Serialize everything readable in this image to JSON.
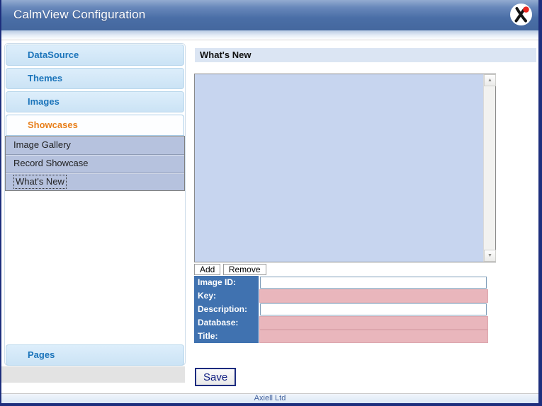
{
  "window": {
    "title": "CalmView Configuration",
    "logo_name": "axiell-logo"
  },
  "sidebar": {
    "sections": [
      {
        "label": "DataSource",
        "state": "collapsed"
      },
      {
        "label": "Themes",
        "state": "collapsed"
      },
      {
        "label": "Images",
        "state": "collapsed"
      },
      {
        "label": "Showcases",
        "state": "expanded",
        "items": [
          {
            "label": "Image Gallery",
            "selected": false
          },
          {
            "label": "Record Showcase",
            "selected": false
          },
          {
            "label": "What's New",
            "selected": true
          }
        ]
      },
      {
        "label": "Pages",
        "state": "collapsed"
      }
    ]
  },
  "main": {
    "heading": "What's New",
    "listbox": {
      "items": [],
      "scroll_up_glyph": "▲",
      "scroll_down_glyph": "▼"
    },
    "toolbar": {
      "add_label": "Add",
      "remove_label": "Remove"
    },
    "form": {
      "fields": [
        {
          "label": "Image ID:",
          "value": "",
          "state": "editable"
        },
        {
          "label": "Key:",
          "value": "",
          "state": "locked"
        },
        {
          "label": "Description:",
          "value": "",
          "state": "editable"
        },
        {
          "label": "Database:",
          "value": "",
          "state": "locked"
        },
        {
          "label": "Title:",
          "value": "",
          "state": "locked"
        }
      ]
    },
    "save_label": "Save"
  },
  "footer": {
    "text": "Axiell Ltd"
  },
  "colors": {
    "titlebar_blue": "#44679e",
    "accent_blue": "#1b74ba",
    "active_orange": "#e8801c",
    "submenu_bg": "#b6c2de",
    "listbox_bg": "#c7d5ef",
    "form_label_bg": "#4072b0",
    "locked_field_pink": "#e9b6bc",
    "frame_navy": "#1d2e7d",
    "heading_bar_bg": "#dbe5f3"
  }
}
